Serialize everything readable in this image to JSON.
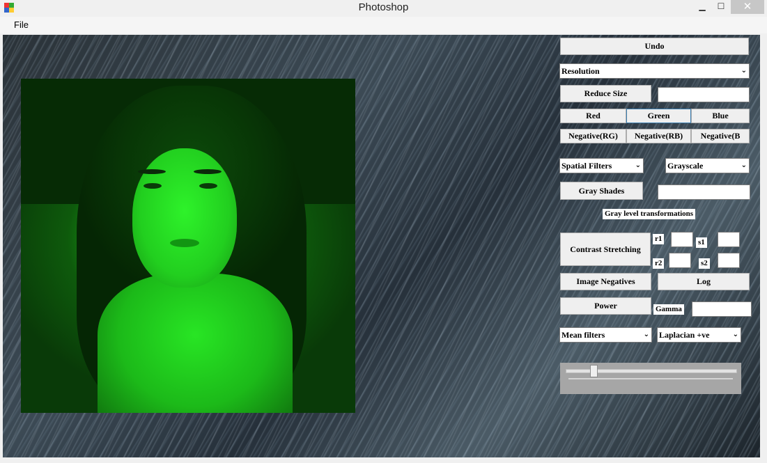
{
  "window": {
    "title": "Photoshop",
    "minimize": "▁",
    "maximize": "☐",
    "close": "✕"
  },
  "menu": {
    "file": "File"
  },
  "colors": {
    "canvas_dark": "#2a3238",
    "image_green": "#22d020",
    "slider_panel": "#a6a6a6"
  },
  "controls": {
    "undo": "Undo",
    "resolution_select": "Resolution",
    "reduce_size": "Reduce Size",
    "reduce_size_value": "",
    "red": "Red",
    "green": "Green",
    "blue": "Blue",
    "neg_rg": "Negative(RG)",
    "neg_rb": "Negative(RB)",
    "neg_b": "Negative(B",
    "spatial_filters_select": "Spatial Filters",
    "grayscale_select": "Grayscale",
    "gray_shades": "Gray Shades",
    "gray_shades_value": "",
    "gray_level_label": "Gray level transformations",
    "contrast_stretching": "Contrast Stretching",
    "r1": "r1",
    "s1": "s1",
    "r2": "r2",
    "s2": "s2",
    "image_negatives": "Image Negatives",
    "log": "Log",
    "power": "Power",
    "gamma_label": "Gamma",
    "gamma_value": "",
    "mean_filters_select": "Mean filters",
    "laplacian_select": "Laplacian +ve"
  },
  "slider": {
    "value_fraction": 0.15
  },
  "icons": {
    "app": "app-icon",
    "chevron": "chevron-down-icon"
  }
}
